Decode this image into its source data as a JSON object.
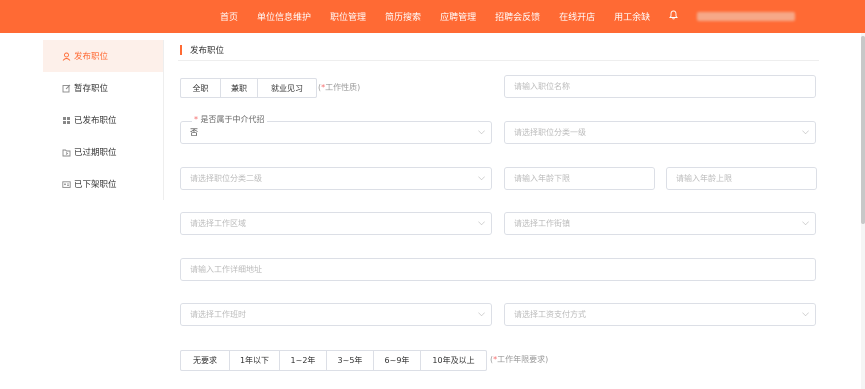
{
  "topbar": {
    "nav": [
      "首页",
      "单位信息维护",
      "职位管理",
      "简历搜索",
      "应聘管理",
      "招聘会反馈",
      "在线开店",
      "用工余缺"
    ],
    "user_name": "上海广麦人力资源有限公司"
  },
  "sidebar": {
    "items": [
      {
        "label": "发布职位",
        "icon": "user-icon",
        "active": true
      },
      {
        "label": "暂存职位",
        "icon": "edit-icon"
      },
      {
        "label": "已发布职位",
        "icon": "grid-icon"
      },
      {
        "label": "已过期职位",
        "icon": "folder-icon"
      },
      {
        "label": "已下架职位",
        "icon": "id-card-icon"
      }
    ]
  },
  "section": {
    "title": "发布职位"
  },
  "form": {
    "job_nature": {
      "options": [
        "全职",
        "兼职",
        "就业见习"
      ],
      "hint_star": "*",
      "hint_text": "工作性质"
    },
    "job_name": {
      "placeholder": "请输入职位名称"
    },
    "agency": {
      "label_star": "*",
      "label": "是否属于中介代招",
      "value": "否"
    },
    "category_1": {
      "placeholder": "请选择职位分类一级"
    },
    "category_2": {
      "placeholder": "请选择职位分类二级"
    },
    "age_min": {
      "placeholder": "请输入年龄下限"
    },
    "age_max": {
      "placeholder": "请输入年龄上限"
    },
    "work_district": {
      "placeholder": "请选择工作区域"
    },
    "work_street": {
      "placeholder": "请选择工作街镇"
    },
    "address": {
      "placeholder": "请输入工作详细地址"
    },
    "work_hours": {
      "placeholder": "请选择工作班时"
    },
    "pay_method": {
      "placeholder": "请选择工资支付方式"
    },
    "experience": {
      "options": [
        "无要求",
        "1年以下",
        "1~2年",
        "3~5年",
        "6~9年",
        "10年及以上"
      ],
      "hint_star": "*",
      "hint_text": "工作年限要求"
    }
  },
  "colors": {
    "accent": "#ff6a34",
    "active_bg": "#fdf0ea",
    "required": "#f56c6c"
  }
}
